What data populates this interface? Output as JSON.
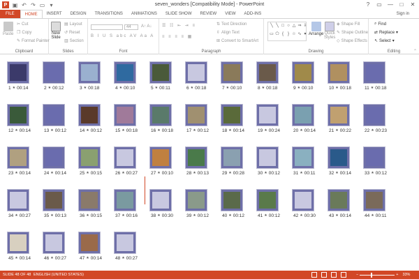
{
  "window": {
    "title": "seven_wonders [Compatibility Mode] - PowerPoint",
    "app_badge": "P",
    "controls": [
      "?",
      "▭",
      "—",
      "□",
      "✕"
    ]
  },
  "ribbon_tabs": [
    "FILE",
    "HOME",
    "INSERT",
    "DESIGN",
    "TRANSITIONS",
    "ANIMATIONS",
    "SLIDE SHOW",
    "REVIEW",
    "VIEW",
    "ADD-INS"
  ],
  "active_tab": "HOME",
  "signin": "Sign in",
  "groups": {
    "clipboard": {
      "label": "Clipboard",
      "paste": "Paste",
      "cut": "Cut",
      "copy": "Copy",
      "format_painter": "Format Painter"
    },
    "slides": {
      "label": "Slides",
      "new_slide": "New",
      "new_slide_2": "Slide",
      "layout": "Layout",
      "reset": "Reset",
      "section": "Section"
    },
    "font": {
      "label": "Font",
      "size": "44"
    },
    "paragraph": {
      "label": "Paragraph",
      "text_direction": "Text Direction",
      "align_text": "Align Text",
      "convert_smartart": "Convert to SmartArt"
    },
    "drawing": {
      "label": "Drawing",
      "arrange": "Arrange",
      "quick_styles": "Quick",
      "quick_styles_2": "Styles",
      "shape_fill": "Shape Fill",
      "shape_outline": "Shape Outline",
      "shape_effects": "Shape Effects"
    },
    "editing": {
      "label": "Editing",
      "find": "Find",
      "replace": "Replace",
      "select": "Select"
    }
  },
  "slides": [
    {
      "n": "1",
      "t": "00:14",
      "c": "#3b3a6a"
    },
    {
      "n": "2",
      "t": "00:12",
      "c": "#6a6cae"
    },
    {
      "n": "3",
      "t": "00:18",
      "c": "#9ab0cf"
    },
    {
      "n": "4",
      "t": "00:10",
      "c": "#2f6aa0"
    },
    {
      "n": "5",
      "t": "00:11",
      "c": "#4a5a3a"
    },
    {
      "n": "6",
      "t": "00:18",
      "c": "#c8c8e0"
    },
    {
      "n": "7",
      "t": "00:10",
      "c": "#8a7a5a"
    },
    {
      "n": "8",
      "t": "00:18",
      "c": "#6a5a4a"
    },
    {
      "n": "9",
      "t": "00:10",
      "c": "#a08a4a"
    },
    {
      "n": "10",
      "t": "00:18",
      "c": "#b09060"
    },
    {
      "n": "11",
      "t": "00:18",
      "c": "#6a6cae"
    },
    {
      "n": "12",
      "t": "00:14",
      "c": "#3a5a3a"
    },
    {
      "n": "13",
      "t": "00:12",
      "c": "#6a6cae"
    },
    {
      "n": "14",
      "t": "00:12",
      "c": "#5a3a2a"
    },
    {
      "n": "15",
      "t": "00:18",
      "c": "#a07a9a"
    },
    {
      "n": "16",
      "t": "00:18",
      "c": "#5a7a6a"
    },
    {
      "n": "17",
      "t": "00:12",
      "c": "#a09070"
    },
    {
      "n": "18",
      "t": "00:14",
      "c": "#5a6a3a"
    },
    {
      "n": "19",
      "t": "00:24",
      "c": "#c8c8e0"
    },
    {
      "n": "20",
      "t": "00:14",
      "c": "#7aa0b0"
    },
    {
      "n": "21",
      "t": "00:22",
      "c": "#c0a070"
    },
    {
      "n": "22",
      "t": "00:23",
      "c": "#6a6cae"
    },
    {
      "n": "23",
      "t": "00:14",
      "c": "#b0a080"
    },
    {
      "n": "24",
      "t": "00:14",
      "c": "#6a6cae"
    },
    {
      "n": "25",
      "t": "00:15",
      "c": "#8aa070"
    },
    {
      "n": "26",
      "t": "00:27",
      "c": "#c8c8e0"
    },
    {
      "n": "27",
      "t": "00:10",
      "c": "#c08040"
    },
    {
      "n": "28",
      "t": "00:13",
      "c": "#4a7a4a"
    },
    {
      "n": "29",
      "t": "00:28",
      "c": "#8aa0b0"
    },
    {
      "n": "30",
      "t": "00:12",
      "c": "#c8c8e0"
    },
    {
      "n": "31",
      "t": "00:11",
      "c": "#8ab0c0"
    },
    {
      "n": "32",
      "t": "00:14",
      "c": "#2a5a8a"
    },
    {
      "n": "33",
      "t": "00:12",
      "c": "#6a6cae"
    },
    {
      "n": "34",
      "t": "00:27",
      "c": "#c8c8e0"
    },
    {
      "n": "35",
      "t": "00:13",
      "c": "#6a5a4a"
    },
    {
      "n": "36",
      "t": "00:15",
      "c": "#8a7a6a"
    },
    {
      "n": "37",
      "t": "00:16",
      "c": "#7a9aa0"
    },
    {
      "n": "38",
      "t": "00:30",
      "c": "#c8c8e0"
    },
    {
      "n": "39",
      "t": "00:12",
      "c": "#8a9a8a"
    },
    {
      "n": "40",
      "t": "00:12",
      "c": "#5a6a4a"
    },
    {
      "n": "41",
      "t": "00:12",
      "c": "#5a7a4a"
    },
    {
      "n": "42",
      "t": "00:30",
      "c": "#c8c8e0"
    },
    {
      "n": "43",
      "t": "00:14",
      "c": "#6a7a5a"
    },
    {
      "n": "44",
      "t": "00:11",
      "c": "#7a6a5a"
    },
    {
      "n": "45",
      "t": "00:14",
      "c": "#d8d0c0"
    },
    {
      "n": "46",
      "t": "00:27",
      "c": "#c8c8e0"
    },
    {
      "n": "47",
      "t": "00:14",
      "c": "#9a6a4a"
    },
    {
      "n": "48",
      "t": "00:27",
      "c": "#c8c8e0"
    }
  ],
  "status": {
    "slide_counter": "SLIDE 48 OF 48",
    "language": "ENGLISH (UNITED STATES)",
    "zoom_pct": "33%",
    "zoom_level": 0.33,
    "zoom_minus": "−",
    "zoom_plus": "+"
  },
  "colors": {
    "accent": "#d24726",
    "slide_bg": "#6e6fa8"
  }
}
